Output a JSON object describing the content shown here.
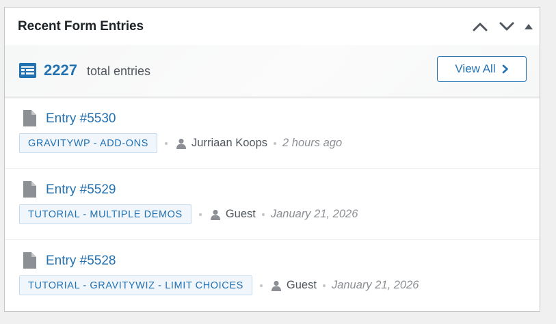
{
  "widget": {
    "title": "Recent Form Entries",
    "controls": [
      "chevron-up-icon",
      "chevron-down-icon",
      "triangle-up-icon"
    ]
  },
  "summary": {
    "count": "2227",
    "label": "total entries",
    "view_all_label": "View All",
    "icon": "list-table-icon"
  },
  "entries": [
    {
      "title": "Entry #5530",
      "form": "GRAVITYWP - ADD-ONS",
      "user": "Jurriaan Koops",
      "date": "2 hours ago"
    },
    {
      "title": "Entry #5529",
      "form": "TUTORIAL - MULTIPLE DEMOS",
      "user": "Guest",
      "date": "January 21, 2026"
    },
    {
      "title": "Entry #5528",
      "form": "TUTORIAL - GRAVITYWIZ - LIMIT CHOICES",
      "user": "Guest",
      "date": "January 21, 2026"
    }
  ],
  "colors": {
    "accent": "#2271b1",
    "tag_bg": "#f0f6fc",
    "muted": "#50575e",
    "date": "#8c8f94"
  }
}
